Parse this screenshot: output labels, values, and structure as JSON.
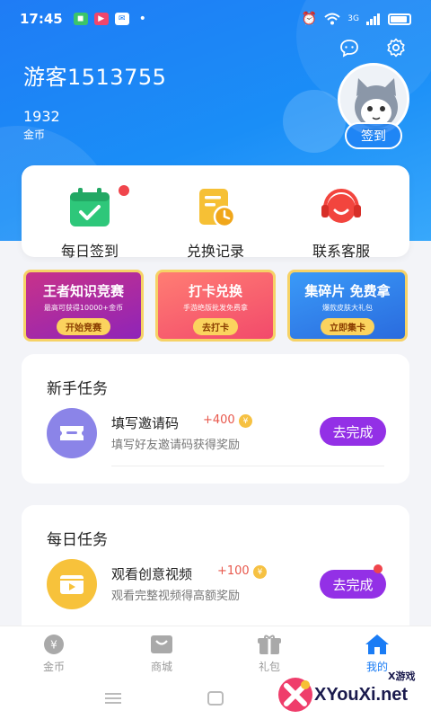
{
  "status_bar": {
    "time": "17:45",
    "network": "3G"
  },
  "profile": {
    "username": "游客1513755",
    "coins_value": "1932",
    "coins_label": "金币",
    "signin_label": "签到"
  },
  "quick_actions": [
    {
      "label": "每日签到"
    },
    {
      "label": "兑换记录"
    },
    {
      "label": "联系客服"
    }
  ],
  "promos": [
    {
      "title": "王者知识竞赛",
      "subtitle": "最高可获得10000+金币",
      "button": "开始竞赛"
    },
    {
      "title": "打卡兑换",
      "subtitle": "手游绝版批发免费拿",
      "button": "去打卡"
    },
    {
      "title": "集碎片 免费拿",
      "subtitle": "爆款皮肤大礼包",
      "button": "立即集卡"
    }
  ],
  "newbie_tasks": {
    "title": "新手任务",
    "items": [
      {
        "name": "填写邀请码",
        "reward": "+400",
        "desc": "填写好友邀请码获得奖励",
        "button": "去完成"
      }
    ]
  },
  "daily_tasks": {
    "title": "每日任务",
    "items": [
      {
        "name": "观看创意视频",
        "reward": "+100",
        "desc": "观看完整视频得高额奖励",
        "button": "去完成"
      }
    ]
  },
  "tabs": [
    {
      "label": "金币",
      "active": false
    },
    {
      "label": "商城",
      "active": false
    },
    {
      "label": "礼包",
      "active": false
    },
    {
      "label": "我的",
      "active": true
    }
  ],
  "watermark": {
    "text": "XYouXi.net",
    "small": "X游戏"
  },
  "colors": {
    "primary": "#1a7cf5",
    "task_button": "#9330e6",
    "reward": "#e8584c"
  }
}
